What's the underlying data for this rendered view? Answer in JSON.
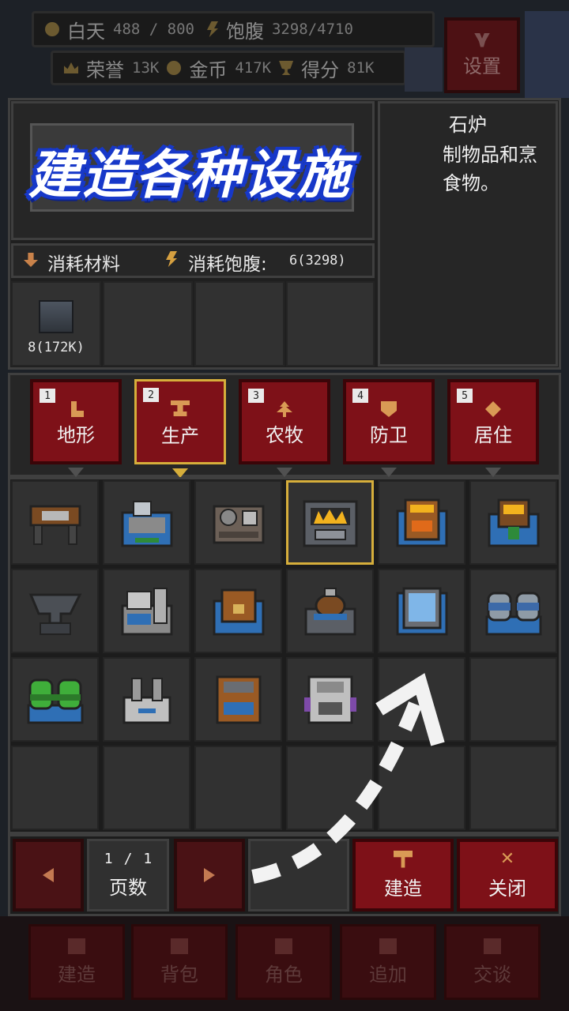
{
  "hud": {
    "day_label": "白天",
    "day_value": "488 / 800",
    "satiety_label": "饱腹",
    "satiety_value": "3298/4710",
    "honor_label": "荣誉",
    "honor_value": "13K",
    "gold_label": "金币",
    "gold_value": "417K",
    "score_label": "得分",
    "score_value": "81K",
    "settings_label": "设置"
  },
  "overlay_title": "建造各种设施",
  "description": {
    "name": "石炉",
    "line1": "制物品和烹",
    "line2": "食物。"
  },
  "cost": {
    "materials_label": "消耗材料",
    "satiety_label": "消耗饱腹:",
    "satiety_value": "6(3298)"
  },
  "materials": [
    {
      "count": "8(172K)",
      "icon": "stone-block-icon"
    }
  ],
  "tabs": [
    {
      "num": "1",
      "label": "地形",
      "icon": "boot-icon"
    },
    {
      "num": "2",
      "label": "生产",
      "icon": "anvil-table-icon"
    },
    {
      "num": "3",
      "label": "农牧",
      "icon": "sprout-icon"
    },
    {
      "num": "4",
      "label": "防卫",
      "icon": "shield-icon"
    },
    {
      "num": "5",
      "label": "居住",
      "icon": "diamond-icon"
    }
  ],
  "pager": {
    "current": "1",
    "sep": "/",
    "total": "1",
    "label": "页数"
  },
  "actions": {
    "build_label": "建造",
    "close_label": "关闭"
  },
  "bottom_nav": [
    "建造",
    "背包",
    "角色",
    "追加",
    "交谈"
  ],
  "colors": {
    "accent_red": "#7e1118",
    "selection_gold": "#d6ae3b",
    "title_blue": "#1738c9"
  }
}
